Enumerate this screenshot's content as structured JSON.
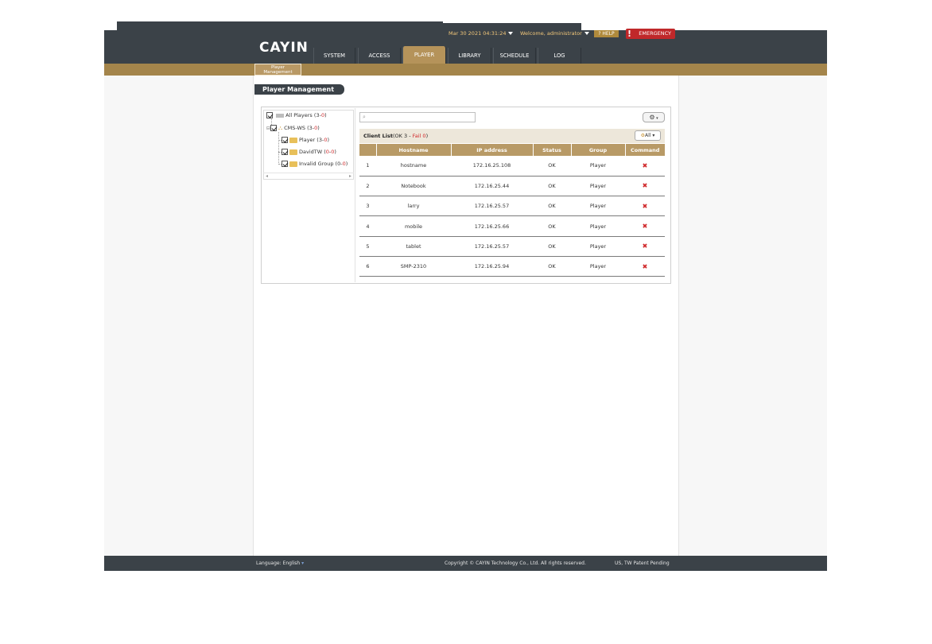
{
  "brand": {
    "logo_text": "CAYIN"
  },
  "header": {
    "datetime": "Mar 30 2021 04:31:24",
    "welcome": "Welcome, administrator",
    "help_label": "HELP",
    "emergency_label": "EMERGENCY"
  },
  "nav": {
    "tabs": [
      {
        "label": "SYSTEM"
      },
      {
        "label": "ACCESS"
      },
      {
        "label": "PLAYER",
        "active": true
      },
      {
        "label": "LIBRARY"
      },
      {
        "label": "SCHEDULE"
      },
      {
        "label": "LOG"
      }
    ],
    "subtab": {
      "line1": "Player",
      "line2": "Management"
    }
  },
  "page": {
    "title": "Player Management"
  },
  "tree": {
    "all_players": {
      "label": "All Players",
      "count_ok": "3",
      "count_fail": "0"
    },
    "server": {
      "label": "CMS-WS",
      "count_ok": "3",
      "count_fail": "0"
    },
    "groups": [
      {
        "label": "Player",
        "count_ok": "3",
        "count_fail": "0"
      },
      {
        "label": "DavidTW",
        "count_ok": "0",
        "count_fail": "0"
      },
      {
        "label": "Invalid Group",
        "count_ok": "0",
        "count_fail": "0"
      }
    ]
  },
  "client_list": {
    "title": "Client List",
    "ok_text": "OK 3",
    "fail_text": "Fail 0",
    "filter_label": "All",
    "columns": [
      "",
      "Hostname",
      "IP address",
      "Status",
      "Group",
      "Command"
    ],
    "rows": [
      {
        "idx": "1",
        "hostname": "hostname",
        "ip": "172.16.25.108",
        "status": "OK",
        "group": "Player",
        "command": "✖"
      },
      {
        "idx": "2",
        "hostname": "Notebook",
        "ip": "172.16.25.44",
        "status": "OK",
        "group": "Player",
        "command": "✖"
      },
      {
        "idx": "3",
        "hostname": "larry",
        "ip": "172.16.25.57",
        "status": "OK",
        "group": "Player",
        "command": "✖"
      },
      {
        "idx": "4",
        "hostname": "mobile",
        "ip": "172.16.25.66",
        "status": "OK",
        "group": "Player",
        "command": "✖"
      },
      {
        "idx": "5",
        "hostname": "tablet",
        "ip": "172.16.25.57",
        "status": "OK",
        "group": "Player",
        "command": "✖"
      },
      {
        "idx": "6",
        "hostname": "SMP-2310",
        "ip": "172.16.25.94",
        "status": "OK",
        "group": "Player",
        "command": "✖"
      }
    ]
  },
  "footer": {
    "language_label": "Language:",
    "language_value": "English",
    "copyright": "Copyright © CAYIN Technology Co., Ltd. All rights reserved.",
    "patent": "US, TW Patent Pending"
  },
  "colors": {
    "header_bg": "#3b4248",
    "gold_bar": "#a4854b",
    "table_header": "#b89a66",
    "emergency": "#c0282a"
  }
}
